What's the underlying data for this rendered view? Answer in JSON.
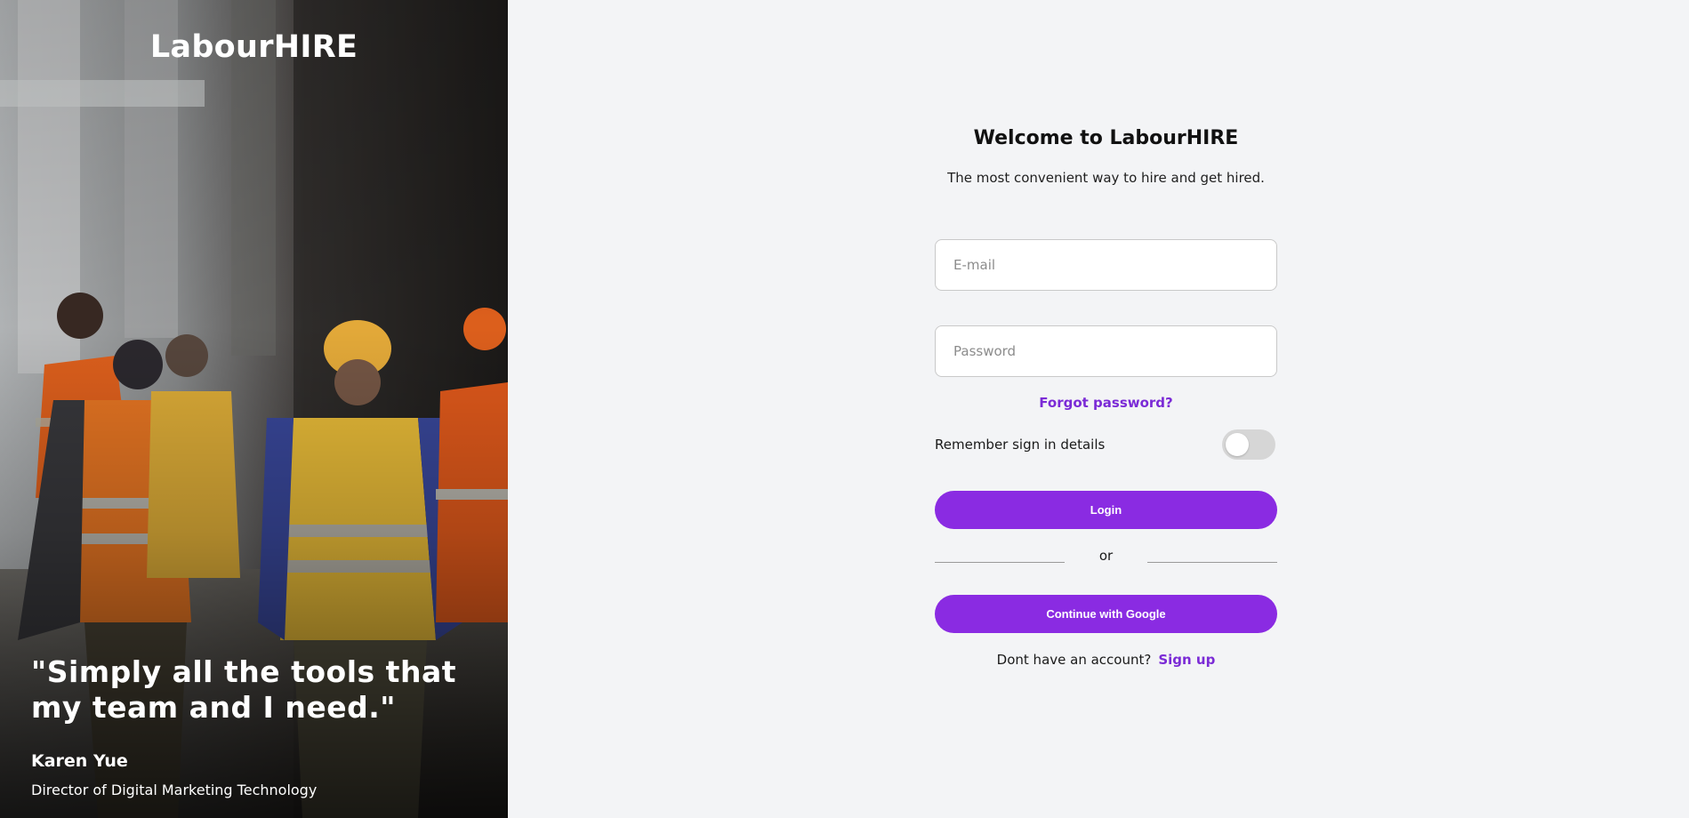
{
  "hero": {
    "brand": "LabourHIRE",
    "quote": "\"Simply all the tools that my team and I need.\"",
    "author_name": "Karen Yue",
    "author_role": "Director of Digital Marketing Technology",
    "image_subject": "construction-workers-in-hi-vis-vests-photo"
  },
  "form": {
    "title": "Welcome to LabourHIRE",
    "subtitle": "The most convenient way to hire and get hired.",
    "email_placeholder": "E-mail",
    "password_placeholder": "Password",
    "forgot_label": "Forgot password?",
    "remember_label": "Remember sign in details",
    "remember_enabled": false,
    "login_label": "Login",
    "or_label": "or",
    "google_label": "Continue with Google",
    "signup_prompt": "Dont have an account?",
    "signup_label": "Sign up"
  },
  "colors": {
    "accent": "#8a2be2",
    "link": "#7b2bd6",
    "background": "#f3f4f6",
    "toggle_off": "#d6d6d6"
  }
}
